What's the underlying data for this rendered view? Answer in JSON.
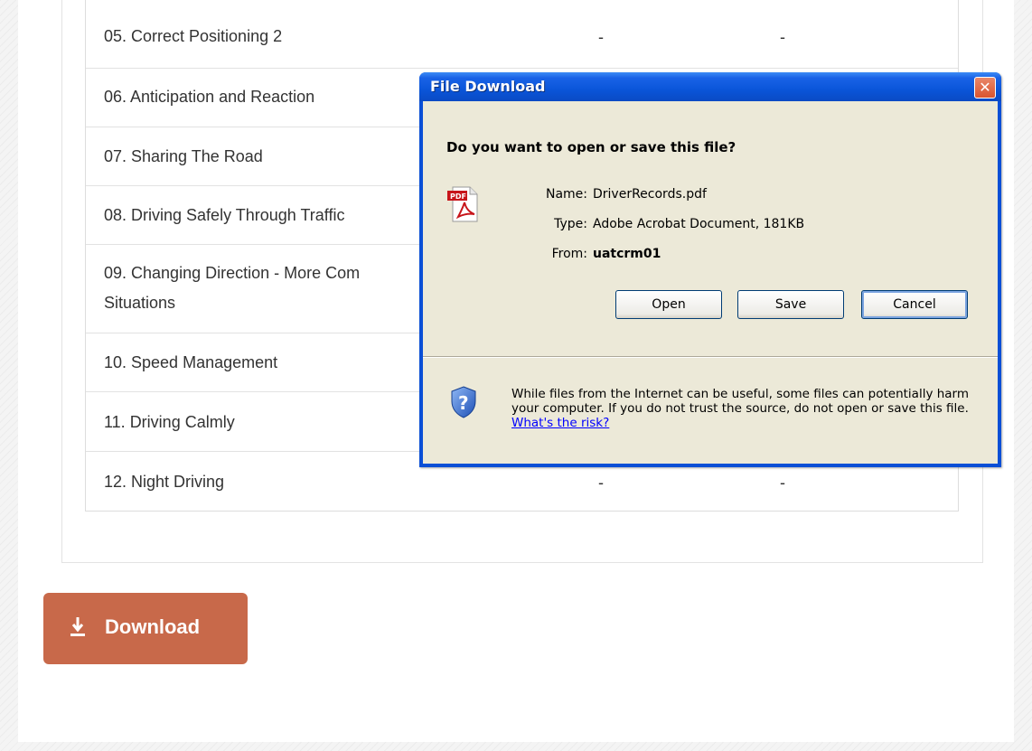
{
  "table": {
    "rows": [
      {
        "name": "05. Correct Positioning 2",
        "col1": "-",
        "col2": "-"
      },
      {
        "name": "06. Anticipation and Reaction",
        "col1": "",
        "col2": ""
      },
      {
        "name": "07. Sharing The Road",
        "col1": "",
        "col2": ""
      },
      {
        "name": "08. Driving Safely Through Traffic",
        "col1": "",
        "col2": ""
      },
      {
        "name": "09. Changing Direction - More Com",
        "name_line2": "Situations",
        "col1": "",
        "col2": ""
      },
      {
        "name": "10. Speed Management",
        "col1": "",
        "col2": ""
      },
      {
        "name": "11. Driving Calmly",
        "col1": "",
        "col2": ""
      },
      {
        "name": "12. Night Driving",
        "col1": "-",
        "col2": "-"
      }
    ]
  },
  "download_button": {
    "label": "Download",
    "icon": "download-arrow-icon",
    "color": "#c8694a"
  },
  "dialog": {
    "title": "File Download",
    "close_label": "✕",
    "question": "Do you want to open or save this file?",
    "file_icon": "pdf-icon",
    "name_label": "Name:",
    "name_value": "DriverRecords.pdf",
    "type_label": "Type:",
    "type_value": "Adobe Acrobat Document, 181KB",
    "from_label": "From:",
    "from_value": "uatcrm01",
    "buttons": {
      "open": "Open",
      "save": "Save",
      "cancel": "Cancel"
    },
    "warning_icon": "shield-question-icon",
    "warning_text": "While files from the Internet can be useful, some files can potentially harm your computer. If you do not trust the source, do not open or save this file.",
    "risk_link": "What's the risk?"
  }
}
